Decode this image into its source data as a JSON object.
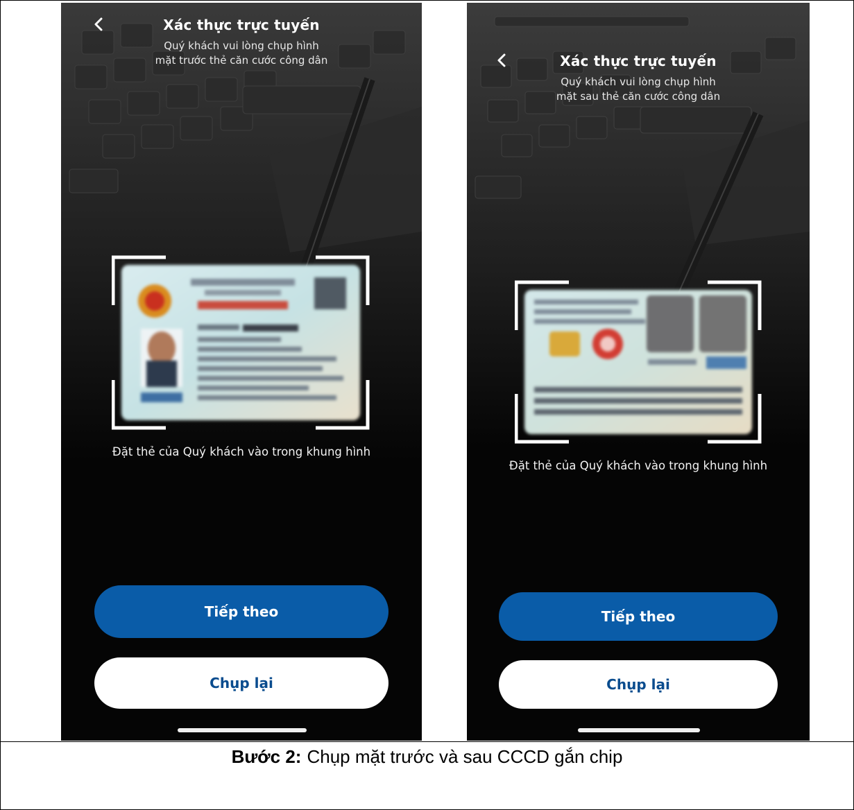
{
  "screens": [
    {
      "header": {
        "title": "Xác thực trực tuyến",
        "subtitle_line1": "Quý khách vui lòng chụp hình",
        "subtitle_line2": "mặt trước thẻ căn cước công dân"
      },
      "hint": "Đặt thẻ của Quý khách vào trong khung hình",
      "primary_button": "Tiếp theo",
      "secondary_button": "Chụp lại"
    },
    {
      "header": {
        "title": "Xác thực trực tuyến",
        "subtitle_line1": "Quý khách vui lòng chụp hình",
        "subtitle_line2": "mặt sau thẻ căn cước công dân"
      },
      "hint": "Đặt thẻ của Quý khách vào trong khung hình",
      "primary_button": "Tiếp theo",
      "secondary_button": "Chụp lại"
    }
  ],
  "caption": {
    "step_label": "Bước 2:",
    "text": "Chụp mặt trước và sau CCCD gắn chip"
  },
  "colors": {
    "primary_button": "#0a5ca8",
    "secondary_button_text": "#0a4c8e",
    "screen_background": "#050505"
  },
  "icons": [
    "chevron-left-icon",
    "frame-corner-icon"
  ]
}
